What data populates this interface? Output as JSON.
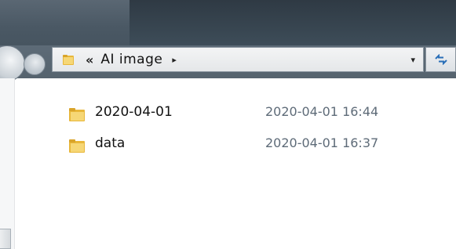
{
  "address_bar": {
    "overflow_chevron": "«",
    "path": "AI image",
    "path_arrow": "▸",
    "dropdown_arrow": "▾",
    "refresh_icon": "refresh-icon"
  },
  "files": [
    {
      "name": "2020-04-01",
      "modified": "2020-04-01 16:44",
      "icon": "folder-icon"
    },
    {
      "name": "data",
      "modified": "2020-04-01 16:37",
      "icon": "folder-icon"
    }
  ],
  "colors": {
    "title_bar": "#36434e",
    "address_bg": "#eef0f2",
    "folder_yellow": "#e8b73a",
    "date_text": "#5e6b78"
  }
}
